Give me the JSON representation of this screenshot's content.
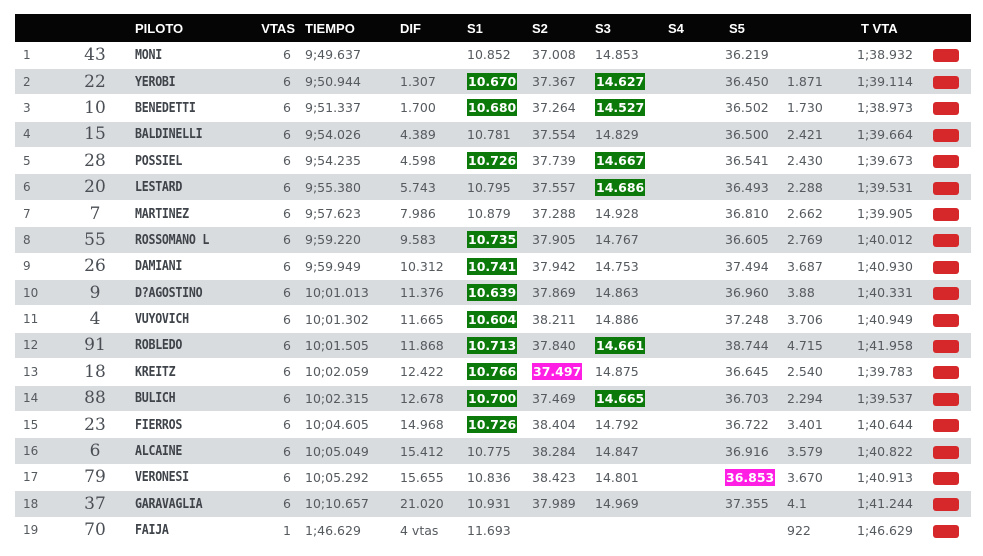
{
  "header": {
    "pos": "",
    "num": "",
    "piloto": "PILOTO",
    "vtas": "VTAS",
    "tiempo": "TIEMPO",
    "dif": "DIF",
    "s1": "S1",
    "s2": "S2",
    "s3": "S3",
    "s4": "S4",
    "s5": "S5",
    "best": "",
    "tvta": "T VTA",
    "flag": ""
  },
  "colors": {
    "best_sector": "#0b7a0b",
    "overall_best_sector": "#ff1ee3",
    "flag_button": "#d6282b",
    "header_bg": "#050505",
    "row_alt": "#d9dcdf"
  },
  "icons": {
    "watermark": "rtl-logo-watermark",
    "row_action": "red-flag-button"
  },
  "rows": [
    {
      "pos": "1",
      "num": "43",
      "name": "MONI",
      "vtas": "6",
      "tiempo": "9;49.637",
      "dif": "",
      "s1": "10.852",
      "s1_hl": "",
      "s2": "37.008",
      "s2_hl": "",
      "s3": "14.853",
      "s3_hl": "",
      "s4": "",
      "s5": "36.219",
      "s5_hl": "",
      "best": "",
      "tvta": "1;38.932"
    },
    {
      "pos": "2",
      "num": "22",
      "name": "YEROBI",
      "vtas": "6",
      "tiempo": "9;50.944",
      "dif": "1.307",
      "s1": "10.670",
      "s1_hl": "green",
      "s2": "37.367",
      "s2_hl": "",
      "s3": "14.627",
      "s3_hl": "green",
      "s4": "",
      "s5": "36.450",
      "s5_hl": "",
      "best": "1.871",
      "tvta": "1;39.114"
    },
    {
      "pos": "3",
      "num": "10",
      "name": "BENEDETTI",
      "vtas": "6",
      "tiempo": "9;51.337",
      "dif": "1.700",
      "s1": "10.680",
      "s1_hl": "green",
      "s2": "37.264",
      "s2_hl": "",
      "s3": "14.527",
      "s3_hl": "green",
      "s4": "",
      "s5": "36.502",
      "s5_hl": "",
      "best": "1.730",
      "tvta": "1;38.973"
    },
    {
      "pos": "4",
      "num": "15",
      "name": "BALDINELLI",
      "vtas": "6",
      "tiempo": "9;54.026",
      "dif": "4.389",
      "s1": "10.781",
      "s1_hl": "",
      "s2": "37.554",
      "s2_hl": "",
      "s3": "14.829",
      "s3_hl": "",
      "s4": "",
      "s5": "36.500",
      "s5_hl": "",
      "best": "2.421",
      "tvta": "1;39.664"
    },
    {
      "pos": "5",
      "num": "28",
      "name": "POSSIEL",
      "vtas": "6",
      "tiempo": "9;54.235",
      "dif": "4.598",
      "s1": "10.726",
      "s1_hl": "green",
      "s2": "37.739",
      "s2_hl": "",
      "s3": "14.667",
      "s3_hl": "green",
      "s4": "",
      "s5": "36.541",
      "s5_hl": "",
      "best": "2.430",
      "tvta": "1;39.673"
    },
    {
      "pos": "6",
      "num": "20",
      "name": "LESTARD",
      "vtas": "6",
      "tiempo": "9;55.380",
      "dif": "5.743",
      "s1": "10.795",
      "s1_hl": "",
      "s2": "37.557",
      "s2_hl": "",
      "s3": "14.686",
      "s3_hl": "green",
      "s4": "",
      "s5": "36.493",
      "s5_hl": "",
      "best": "2.288",
      "tvta": "1;39.531"
    },
    {
      "pos": "7",
      "num": "7",
      "name": "MARTINEZ",
      "vtas": "6",
      "tiempo": "9;57.623",
      "dif": "7.986",
      "s1": "10.879",
      "s1_hl": "",
      "s2": "37.288",
      "s2_hl": "",
      "s3": "14.928",
      "s3_hl": "",
      "s4": "",
      "s5": "36.810",
      "s5_hl": "",
      "best": "2.662",
      "tvta": "1;39.905"
    },
    {
      "pos": "8",
      "num": "55",
      "name": "ROSSOMANO L",
      "vtas": "6",
      "tiempo": "9;59.220",
      "dif": "9.583",
      "s1": "10.735",
      "s1_hl": "green",
      "s2": "37.905",
      "s2_hl": "",
      "s3": "14.767",
      "s3_hl": "",
      "s4": "",
      "s5": "36.605",
      "s5_hl": "",
      "best": "2.769",
      "tvta": "1;40.012"
    },
    {
      "pos": "9",
      "num": "26",
      "name": "DAMIANI",
      "vtas": "6",
      "tiempo": "9;59.949",
      "dif": "10.312",
      "s1": "10.741",
      "s1_hl": "green",
      "s2": "37.942",
      "s2_hl": "",
      "s3": "14.753",
      "s3_hl": "",
      "s4": "",
      "s5": "37.494",
      "s5_hl": "",
      "best": "3.687",
      "tvta": "1;40.930"
    },
    {
      "pos": "10",
      "num": "9",
      "name": "D?AGOSTINO",
      "vtas": "6",
      "tiempo": "10;01.013",
      "dif": "11.376",
      "s1": "10.639",
      "s1_hl": "green",
      "s2": "37.869",
      "s2_hl": "",
      "s3": "14.863",
      "s3_hl": "",
      "s4": "",
      "s5": "36.960",
      "s5_hl": "",
      "best": "3.88",
      "tvta": "1;40.331"
    },
    {
      "pos": "11",
      "num": "4",
      "name": "VUYOVICH",
      "vtas": "6",
      "tiempo": "10;01.302",
      "dif": "11.665",
      "s1": "10.604",
      "s1_hl": "green",
      "s2": "38.211",
      "s2_hl": "",
      "s3": "14.886",
      "s3_hl": "",
      "s4": "",
      "s5": "37.248",
      "s5_hl": "",
      "best": "3.706",
      "tvta": "1;40.949"
    },
    {
      "pos": "12",
      "num": "91",
      "name": "ROBLEDO",
      "vtas": "6",
      "tiempo": "10;01.505",
      "dif": "11.868",
      "s1": "10.713",
      "s1_hl": "green",
      "s2": "37.840",
      "s2_hl": "",
      "s3": "14.661",
      "s3_hl": "green",
      "s4": "",
      "s5": "38.744",
      "s5_hl": "",
      "best": "4.715",
      "tvta": "1;41.958"
    },
    {
      "pos": "13",
      "num": "18",
      "name": "KREITZ",
      "vtas": "6",
      "tiempo": "10;02.059",
      "dif": "12.422",
      "s1": "10.766",
      "s1_hl": "green",
      "s2": "37.497",
      "s2_hl": "pink",
      "s3": "14.875",
      "s3_hl": "",
      "s4": "",
      "s5": "36.645",
      "s5_hl": "",
      "best": "2.540",
      "tvta": "1;39.783"
    },
    {
      "pos": "14",
      "num": "88",
      "name": "BULICH",
      "vtas": "6",
      "tiempo": "10;02.315",
      "dif": "12.678",
      "s1": "10.700",
      "s1_hl": "green",
      "s2": "37.469",
      "s2_hl": "",
      "s3": "14.665",
      "s3_hl": "green",
      "s4": "",
      "s5": "36.703",
      "s5_hl": "",
      "best": "2.294",
      "tvta": "1;39.537"
    },
    {
      "pos": "15",
      "num": "23",
      "name": "FIERROS",
      "vtas": "6",
      "tiempo": "10;04.605",
      "dif": "14.968",
      "s1": "10.726",
      "s1_hl": "green",
      "s2": "38.404",
      "s2_hl": "",
      "s3": "14.792",
      "s3_hl": "",
      "s4": "",
      "s5": "36.722",
      "s5_hl": "",
      "best": "3.401",
      "tvta": "1;40.644"
    },
    {
      "pos": "16",
      "num": "6",
      "name": "ALCAINE",
      "vtas": "6",
      "tiempo": "10;05.049",
      "dif": "15.412",
      "s1": "10.775",
      "s1_hl": "",
      "s2": "38.284",
      "s2_hl": "",
      "s3": "14.847",
      "s3_hl": "",
      "s4": "",
      "s5": "36.916",
      "s5_hl": "",
      "best": "3.579",
      "tvta": "1;40.822"
    },
    {
      "pos": "17",
      "num": "79",
      "name": "VERONESI",
      "vtas": "6",
      "tiempo": "10;05.292",
      "dif": "15.655",
      "s1": "10.836",
      "s1_hl": "",
      "s2": "38.423",
      "s2_hl": "",
      "s3": "14.801",
      "s3_hl": "",
      "s4": "",
      "s5": "36.853",
      "s5_hl": "pink",
      "best": "3.670",
      "tvta": "1;40.913"
    },
    {
      "pos": "18",
      "num": "37",
      "name": "GARAVAGLIA",
      "vtas": "6",
      "tiempo": "10;10.657",
      "dif": "21.020",
      "s1": "10.931",
      "s1_hl": "",
      "s2": "37.989",
      "s2_hl": "",
      "s3": "14.969",
      "s3_hl": "",
      "s4": "",
      "s5": "37.355",
      "s5_hl": "",
      "best": "4.1",
      "tvta": "1;41.244"
    },
    {
      "pos": "19",
      "num": "70",
      "name": "FAIJA",
      "vtas": "1",
      "tiempo": "1;46.629",
      "dif": "4 vtas",
      "s1": "11.693",
      "s1_hl": "",
      "s2": "",
      "s2_hl": "",
      "s3": "",
      "s3_hl": "",
      "s4": "",
      "s5": "",
      "s5_hl": "",
      "best": "922",
      "tvta": "1;46.629"
    }
  ]
}
